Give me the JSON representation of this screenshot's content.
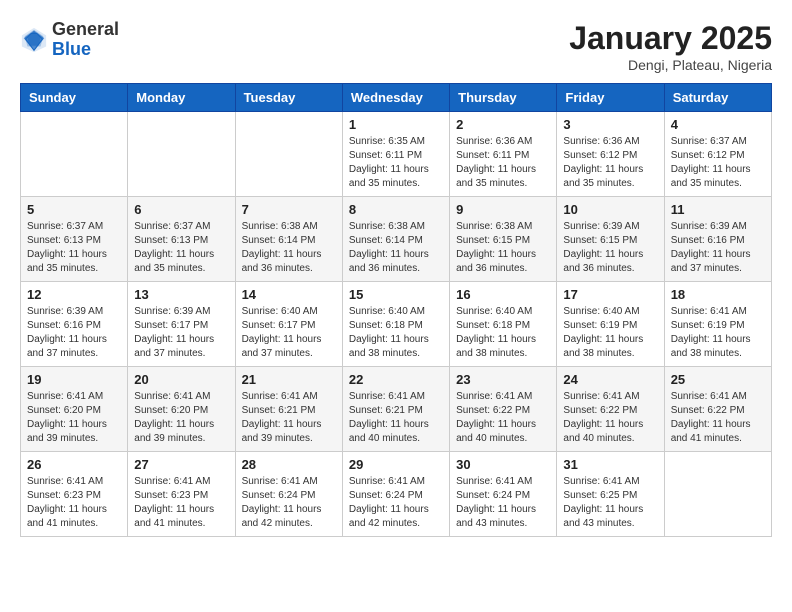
{
  "header": {
    "logo": {
      "general": "General",
      "blue": "Blue"
    },
    "title": "January 2025",
    "subtitle": "Dengi, Plateau, Nigeria"
  },
  "weekdays": [
    "Sunday",
    "Monday",
    "Tuesday",
    "Wednesday",
    "Thursday",
    "Friday",
    "Saturday"
  ],
  "weeks": [
    [
      {
        "day": "",
        "info": ""
      },
      {
        "day": "",
        "info": ""
      },
      {
        "day": "",
        "info": ""
      },
      {
        "day": "1",
        "info": "Sunrise: 6:35 AM\nSunset: 6:11 PM\nDaylight: 11 hours\nand 35 minutes."
      },
      {
        "day": "2",
        "info": "Sunrise: 6:36 AM\nSunset: 6:11 PM\nDaylight: 11 hours\nand 35 minutes."
      },
      {
        "day": "3",
        "info": "Sunrise: 6:36 AM\nSunset: 6:12 PM\nDaylight: 11 hours\nand 35 minutes."
      },
      {
        "day": "4",
        "info": "Sunrise: 6:37 AM\nSunset: 6:12 PM\nDaylight: 11 hours\nand 35 minutes."
      }
    ],
    [
      {
        "day": "5",
        "info": "Sunrise: 6:37 AM\nSunset: 6:13 PM\nDaylight: 11 hours\nand 35 minutes."
      },
      {
        "day": "6",
        "info": "Sunrise: 6:37 AM\nSunset: 6:13 PM\nDaylight: 11 hours\nand 35 minutes."
      },
      {
        "day": "7",
        "info": "Sunrise: 6:38 AM\nSunset: 6:14 PM\nDaylight: 11 hours\nand 36 minutes."
      },
      {
        "day": "8",
        "info": "Sunrise: 6:38 AM\nSunset: 6:14 PM\nDaylight: 11 hours\nand 36 minutes."
      },
      {
        "day": "9",
        "info": "Sunrise: 6:38 AM\nSunset: 6:15 PM\nDaylight: 11 hours\nand 36 minutes."
      },
      {
        "day": "10",
        "info": "Sunrise: 6:39 AM\nSunset: 6:15 PM\nDaylight: 11 hours\nand 36 minutes."
      },
      {
        "day": "11",
        "info": "Sunrise: 6:39 AM\nSunset: 6:16 PM\nDaylight: 11 hours\nand 37 minutes."
      }
    ],
    [
      {
        "day": "12",
        "info": "Sunrise: 6:39 AM\nSunset: 6:16 PM\nDaylight: 11 hours\nand 37 minutes."
      },
      {
        "day": "13",
        "info": "Sunrise: 6:39 AM\nSunset: 6:17 PM\nDaylight: 11 hours\nand 37 minutes."
      },
      {
        "day": "14",
        "info": "Sunrise: 6:40 AM\nSunset: 6:17 PM\nDaylight: 11 hours\nand 37 minutes."
      },
      {
        "day": "15",
        "info": "Sunrise: 6:40 AM\nSunset: 6:18 PM\nDaylight: 11 hours\nand 38 minutes."
      },
      {
        "day": "16",
        "info": "Sunrise: 6:40 AM\nSunset: 6:18 PM\nDaylight: 11 hours\nand 38 minutes."
      },
      {
        "day": "17",
        "info": "Sunrise: 6:40 AM\nSunset: 6:19 PM\nDaylight: 11 hours\nand 38 minutes."
      },
      {
        "day": "18",
        "info": "Sunrise: 6:41 AM\nSunset: 6:19 PM\nDaylight: 11 hours\nand 38 minutes."
      }
    ],
    [
      {
        "day": "19",
        "info": "Sunrise: 6:41 AM\nSunset: 6:20 PM\nDaylight: 11 hours\nand 39 minutes."
      },
      {
        "day": "20",
        "info": "Sunrise: 6:41 AM\nSunset: 6:20 PM\nDaylight: 11 hours\nand 39 minutes."
      },
      {
        "day": "21",
        "info": "Sunrise: 6:41 AM\nSunset: 6:21 PM\nDaylight: 11 hours\nand 39 minutes."
      },
      {
        "day": "22",
        "info": "Sunrise: 6:41 AM\nSunset: 6:21 PM\nDaylight: 11 hours\nand 40 minutes."
      },
      {
        "day": "23",
        "info": "Sunrise: 6:41 AM\nSunset: 6:22 PM\nDaylight: 11 hours\nand 40 minutes."
      },
      {
        "day": "24",
        "info": "Sunrise: 6:41 AM\nSunset: 6:22 PM\nDaylight: 11 hours\nand 40 minutes."
      },
      {
        "day": "25",
        "info": "Sunrise: 6:41 AM\nSunset: 6:22 PM\nDaylight: 11 hours\nand 41 minutes."
      }
    ],
    [
      {
        "day": "26",
        "info": "Sunrise: 6:41 AM\nSunset: 6:23 PM\nDaylight: 11 hours\nand 41 minutes."
      },
      {
        "day": "27",
        "info": "Sunrise: 6:41 AM\nSunset: 6:23 PM\nDaylight: 11 hours\nand 41 minutes."
      },
      {
        "day": "28",
        "info": "Sunrise: 6:41 AM\nSunset: 6:24 PM\nDaylight: 11 hours\nand 42 minutes."
      },
      {
        "day": "29",
        "info": "Sunrise: 6:41 AM\nSunset: 6:24 PM\nDaylight: 11 hours\nand 42 minutes."
      },
      {
        "day": "30",
        "info": "Sunrise: 6:41 AM\nSunset: 6:24 PM\nDaylight: 11 hours\nand 43 minutes."
      },
      {
        "day": "31",
        "info": "Sunrise: 6:41 AM\nSunset: 6:25 PM\nDaylight: 11 hours\nand 43 minutes."
      },
      {
        "day": "",
        "info": ""
      }
    ]
  ]
}
